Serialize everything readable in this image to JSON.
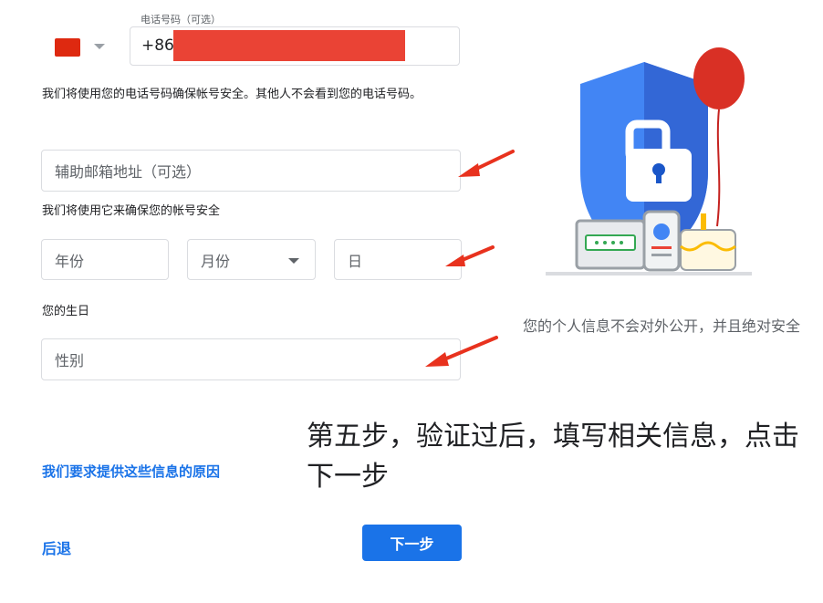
{
  "phone": {
    "label": "电话号码（可选）",
    "country_code": "+86",
    "flag_color": "#de2910",
    "helper": "我们将使用您的电话号码确保帐号安全。其他人不会看到您的电话号码。"
  },
  "recovery_email": {
    "placeholder": "辅助邮箱地址（可选）",
    "helper": "我们将使用它来确保您的帐号安全"
  },
  "birthday": {
    "year_placeholder": "年份",
    "month_placeholder": "月份",
    "day_placeholder": "日",
    "helper": "您的生日"
  },
  "gender": {
    "placeholder": "性别"
  },
  "why_link": "我们要求提供这些信息的原因",
  "back_link": "后退",
  "next_button": "下一步",
  "privacy_text": "您的个人信息不会对外公开，并且绝对安全",
  "annotation": "第五步，验证过后，填写相关信息，点击下一步",
  "colors": {
    "accent": "#1a73e8",
    "redaction": "#ea4335",
    "arrow": "#e8321e",
    "shield": "#4285f4",
    "balloon": "#d93025"
  }
}
